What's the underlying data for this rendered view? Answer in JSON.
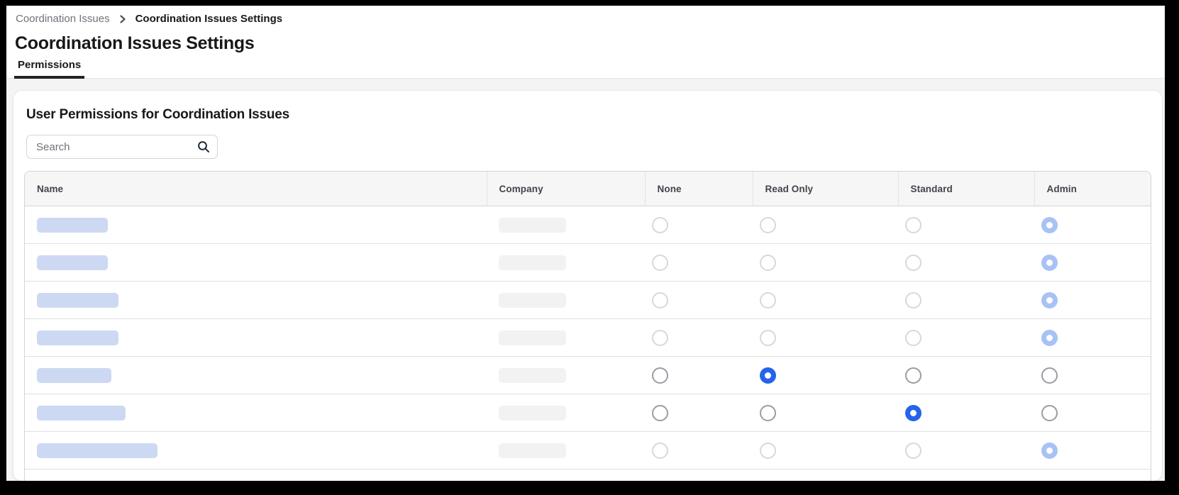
{
  "breadcrumb": {
    "items": [
      {
        "label": "Coordination Issues"
      },
      {
        "label": "Coordination Issues Settings"
      }
    ]
  },
  "page": {
    "title": "Coordination Issues Settings"
  },
  "tab_bar": {
    "tabs": [
      {
        "label": "Permissions",
        "active": true
      }
    ]
  },
  "panel": {
    "heading": "User Permissions for Coordination Issues",
    "search": {
      "placeholder": "Search",
      "value": ""
    }
  },
  "table": {
    "columns": [
      "Name",
      "Company",
      "None",
      "Read Only",
      "Standard",
      "Admin"
    ],
    "permission_options": [
      "None",
      "Read Only",
      "Standard",
      "Admin"
    ],
    "rows": [
      {
        "name_bar_width": 100,
        "company_bar_width": 95,
        "selected": "Admin",
        "enabled": false
      },
      {
        "name_bar_width": 100,
        "company_bar_width": 95,
        "selected": "Admin",
        "enabled": false
      },
      {
        "name_bar_width": 115,
        "company_bar_width": 95,
        "selected": "Admin",
        "enabled": false
      },
      {
        "name_bar_width": 115,
        "company_bar_width": 95,
        "selected": "Admin",
        "enabled": false
      },
      {
        "name_bar_width": 105,
        "company_bar_width": 95,
        "selected": "Read Only",
        "enabled": true
      },
      {
        "name_bar_width": 125,
        "company_bar_width": 95,
        "selected": "Standard",
        "enabled": true
      },
      {
        "name_bar_width": 170,
        "company_bar_width": 95,
        "selected": "Admin",
        "enabled": false
      }
    ]
  },
  "colors": {
    "accent_blue": "#2563eb",
    "disabled_selected_blue": "#a8c2f6",
    "name_skeleton": "#cdd9f3",
    "company_skeleton": "#f2f2f3",
    "page_background": "#f4f4f5"
  }
}
